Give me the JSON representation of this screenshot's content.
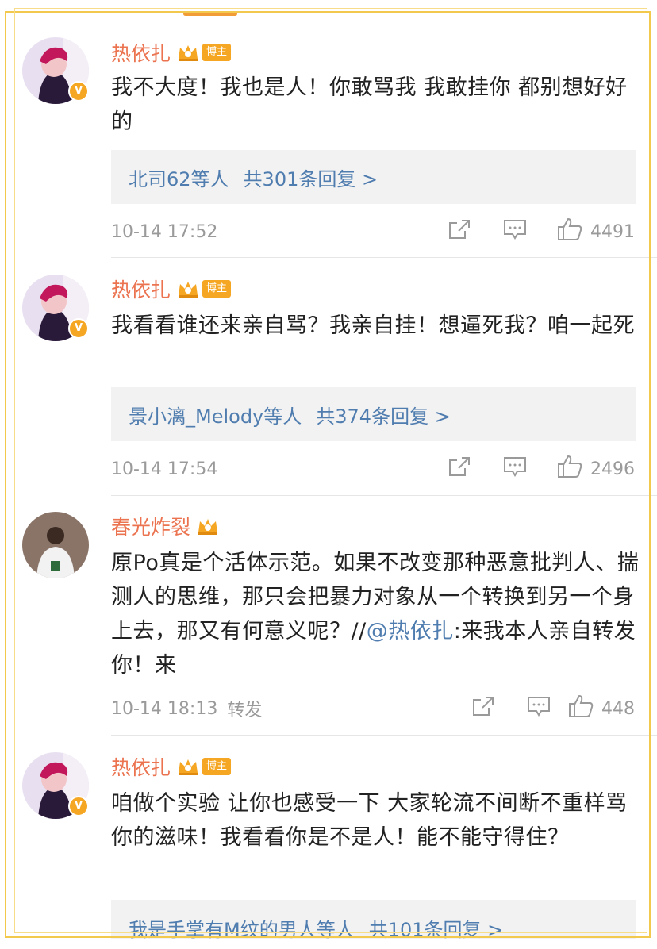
{
  "comments": [
    {
      "username": "热依扎",
      "badge": "博主",
      "text": "我不大度！我也是人！你敢骂我 我敢挂你 都别想好好的",
      "reply_users": "北司62等人",
      "reply_count": "共301条回复 >",
      "time": "10-14 17:52",
      "likes": "4491"
    },
    {
      "username": "热依扎",
      "badge": "博主",
      "text": "我看看谁还来亲自骂？我亲自挂！想逼死我？咱一起死",
      "reply_users": "景小漓_Melody等人",
      "reply_count": "共374条回复 >",
      "time": "10-14 17:54",
      "likes": "2496"
    },
    {
      "username": "春光炸裂",
      "text_before": "原Po真是个活体示范。如果不改变那种恶意批判人、揣测人的思维，那只会把暴力对象从一个转换到另一个身上去，那又有何意义呢？//",
      "mention": "@热依扎",
      "text_after": ":来我本人亲自转发你！来",
      "time": "10-14 18:13",
      "repost_label": "转发",
      "likes": "448"
    },
    {
      "username": "热依扎",
      "badge": "博主",
      "text": "咱做个实验  让你也感受一下 大家轮流不间断不重样骂你的滋味！我看看你是不是人！能不能守得住？",
      "reply_users": "我是手掌有M纹的男人等人",
      "reply_count": "共101条回复 >"
    }
  ],
  "icons": {
    "crown": "crown-icon",
    "share": "share-icon",
    "comment": "comment-icon",
    "like": "thumbs-up-icon",
    "verified": "verified-icon"
  },
  "colors": {
    "username": "#eb7350",
    "link": "#507daf",
    "badge": "#f5a623",
    "meta": "#9a9a9a"
  }
}
